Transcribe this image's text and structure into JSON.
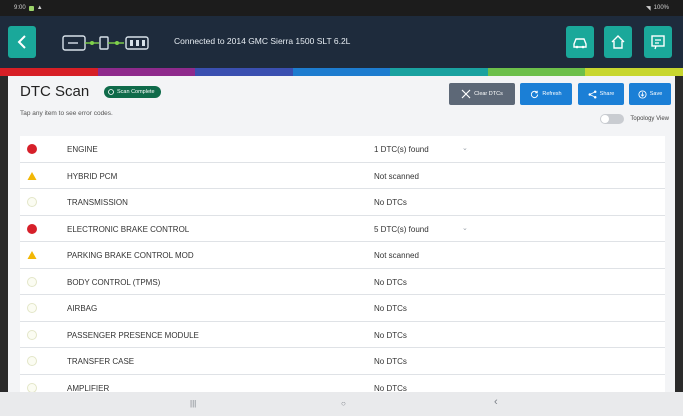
{
  "status_bar": {
    "time": "9:00",
    "right": "100%"
  },
  "header": {
    "back_icon": "chevron-left-icon",
    "connection_text": "Connected to 2014 GMC Sierra 1500 SLT 6.2L",
    "buttons": [
      {
        "name": "vehicle-icon"
      },
      {
        "name": "home-icon"
      },
      {
        "name": "report-icon"
      }
    ]
  },
  "colors": {
    "accent": "#1aa89a",
    "header": "#1e2b3c",
    "error": "#d6202a",
    "warning": "#f2b705",
    "button_blue": "#1b7fd6",
    "button_gray": "#5d6877",
    "strip": [
      "#d71f26",
      "#8e2a8c",
      "#3a4fb0",
      "#1d7ccf",
      "#1aa2a0",
      "#6cbf4a",
      "#c7d62f"
    ]
  },
  "page": {
    "title": "DTC Scan",
    "badge": "Scan Complete",
    "hint": "Tap any item to see error codes.",
    "toggle_label": "Topology View",
    "topology_on": false
  },
  "toolbar": {
    "clear": "Clear DTCs",
    "refresh": "Refresh",
    "share": "Share",
    "save": "Save"
  },
  "rows": [
    {
      "status": "error",
      "name": "ENGINE",
      "result": "1 DTC(s) found",
      "expandable": true
    },
    {
      "status": "warning",
      "name": "HYBRID PCM",
      "result": "Not scanned",
      "expandable": false
    },
    {
      "status": "ok",
      "name": "TRANSMISSION",
      "result": "No DTCs",
      "expandable": false
    },
    {
      "status": "error",
      "name": "ELECTRONIC BRAKE CONTROL",
      "result": "5 DTC(s) found",
      "expandable": true
    },
    {
      "status": "warning",
      "name": "PARKING BRAKE CONTROL MOD",
      "result": "Not scanned",
      "expandable": false
    },
    {
      "status": "ok",
      "name": "BODY CONTROL (TPMS)",
      "result": "No DTCs",
      "expandable": false
    },
    {
      "status": "ok",
      "name": "AIRBAG",
      "result": "No DTCs",
      "expandable": false
    },
    {
      "status": "ok",
      "name": "PASSENGER PRESENCE MODULE",
      "result": "No DTCs",
      "expandable": false
    },
    {
      "status": "ok",
      "name": "TRANSFER CASE",
      "result": "No DTCs",
      "expandable": false
    },
    {
      "status": "ok",
      "name": "AMPLIFIER",
      "result": "No DTCs",
      "expandable": false
    }
  ],
  "nav": {
    "recents": "|||",
    "home": "○",
    "back": "‹"
  }
}
